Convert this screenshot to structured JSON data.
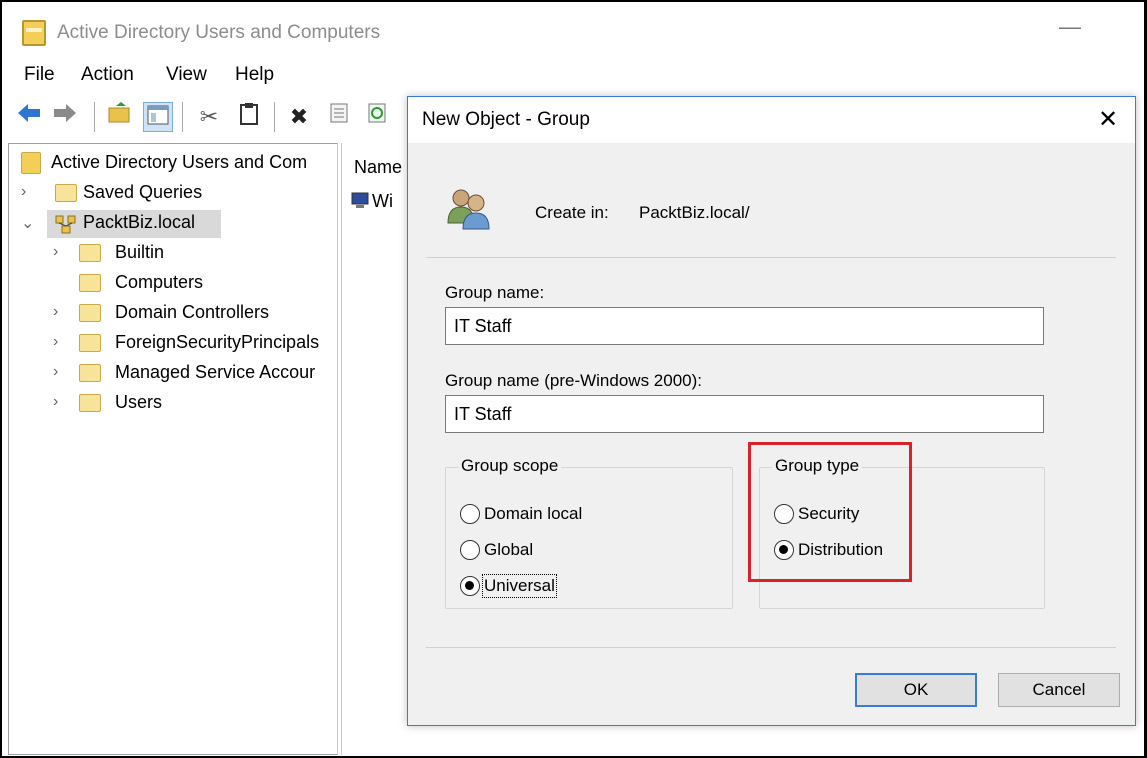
{
  "window": {
    "title": "Active Directory Users and Computers",
    "minimize_glyph": "—"
  },
  "menu": [
    "File",
    "Action",
    "View",
    "Help"
  ],
  "toolbar": {
    "icons": [
      "back-arrow-icon",
      "forward-arrow-icon",
      "up-folder-icon",
      "show-hide-tree-icon",
      "cut-icon",
      "copy-icon",
      "delete-icon",
      "properties-icon",
      "refresh-icon"
    ]
  },
  "tree": {
    "root": "Active Directory Users and Com",
    "items": [
      {
        "label": "Saved Queries"
      },
      {
        "label": "PacktBiz.local"
      },
      {
        "label": "Builtin"
      },
      {
        "label": "Computers"
      },
      {
        "label": "Domain Controllers"
      },
      {
        "label": "ForeignSecurityPrincipals"
      },
      {
        "label": "Managed Service Accour"
      },
      {
        "label": "Users"
      }
    ]
  },
  "list": {
    "header": "Name",
    "first_item": "Wi"
  },
  "dialog": {
    "title": "New Object - Group",
    "close_glyph": "✕",
    "create_in_label": "Create in:",
    "create_in_path": "PacktBiz.local/",
    "group_name_label": "Group name:",
    "group_name_value": "IT Staff",
    "group_name_pre2000_label": "Group name (pre-Windows 2000):",
    "group_name_pre2000_value": "IT Staff",
    "scope": {
      "title": "Group scope",
      "options": [
        "Domain local",
        "Global",
        "Universal"
      ],
      "selected": "Universal"
    },
    "type": {
      "title": "Group type",
      "options": [
        "Security",
        "Distribution"
      ],
      "selected": "Distribution"
    },
    "ok_label": "OK",
    "cancel_label": "Cancel"
  },
  "colors": {
    "highlight": "#d9222a",
    "accent": "#3a7bd5"
  }
}
